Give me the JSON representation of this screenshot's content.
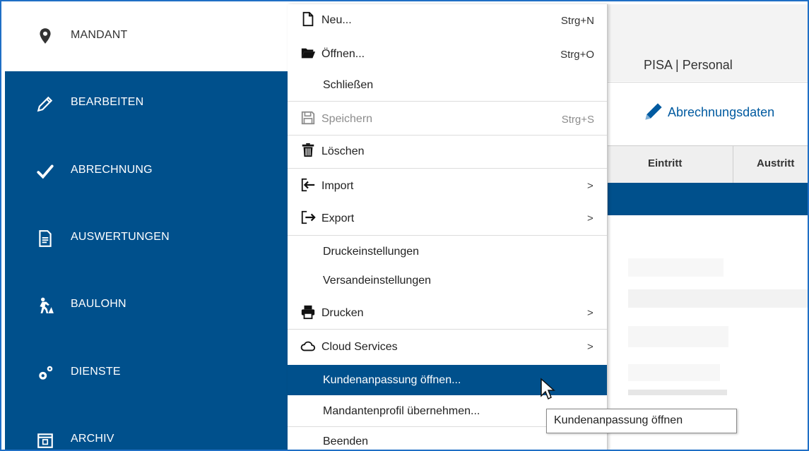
{
  "sidebar": {
    "items": [
      {
        "label": "MANDANT",
        "icon": "map-pin-icon"
      },
      {
        "label": "BEARBEITEN",
        "icon": "pencil-icon"
      },
      {
        "label": "ABRECHNUNG",
        "icon": "checkmark-icon"
      },
      {
        "label": "AUSWERTUNGEN",
        "icon": "document-icon"
      },
      {
        "label": "BAULOHN",
        "icon": "construction-worker-icon"
      },
      {
        "label": "DIENSTE",
        "icon": "gears-icon"
      },
      {
        "label": "ARCHIV",
        "icon": "archive-icon"
      }
    ]
  },
  "menu": {
    "items": [
      {
        "label": "Neu...",
        "shortcut": "Strg+N",
        "icon": "new-file-icon"
      },
      {
        "label": "Öffnen...",
        "shortcut": "Strg+O",
        "icon": "folder-open-icon"
      },
      {
        "label": "Schließen"
      },
      {
        "label": "Speichern",
        "shortcut": "Strg+S",
        "icon": "save-icon",
        "disabled": true
      },
      {
        "label": "Löschen",
        "icon": "trash-icon"
      },
      {
        "label": "Import",
        "icon": "import-icon",
        "submenu": true
      },
      {
        "label": "Export",
        "icon": "export-icon",
        "submenu": true
      },
      {
        "label": "Druckeinstellungen"
      },
      {
        "label": "Versandeinstellungen"
      },
      {
        "label": "Drucken",
        "icon": "printer-icon",
        "submenu": true
      },
      {
        "label": "Cloud Services",
        "icon": "cloud-icon",
        "submenu": true
      },
      {
        "label": "Kundenanpassung öffnen...",
        "highlighted": true
      },
      {
        "label": "Mandantenprofil übernehmen..."
      },
      {
        "label": "Beenden"
      }
    ],
    "submenu_arrow": ">"
  },
  "app": {
    "title": "PISA | Personal"
  },
  "toolbar": {
    "label": "Abrechnungsdaten"
  },
  "grid": {
    "columns": [
      "Eintritt",
      "Austritt"
    ]
  },
  "tooltip": {
    "text": "Kundenanpassung öffnen"
  },
  "colors": {
    "primary": "#00508c",
    "highlight": "#00508c",
    "link": "#005aa0",
    "frame": "#1f6fc5"
  }
}
